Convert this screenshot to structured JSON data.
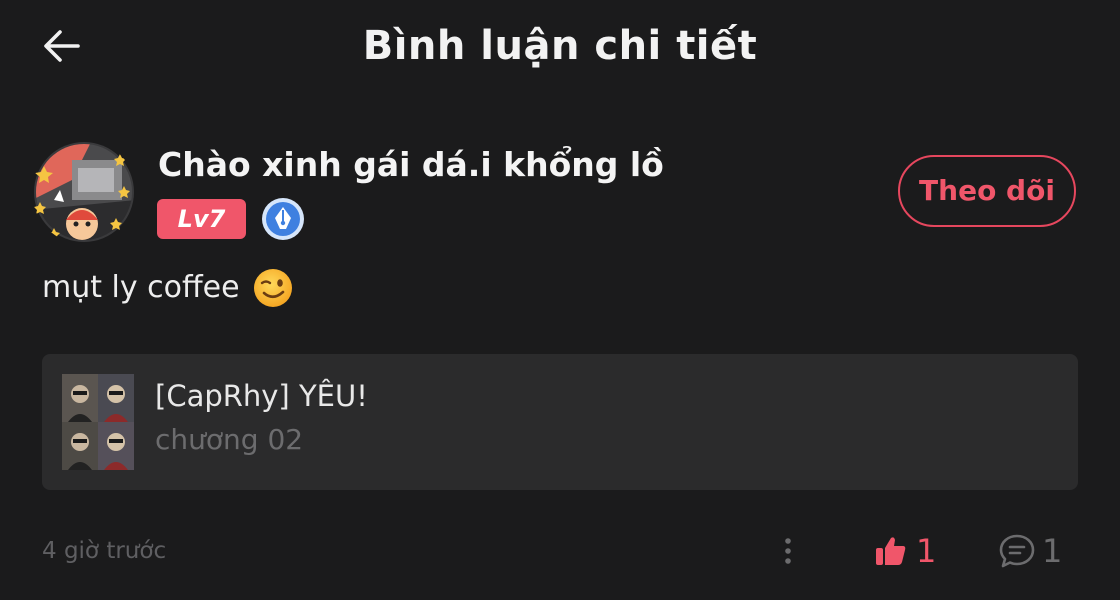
{
  "header": {
    "title": "Bình luận chi tiết",
    "back_icon": "arrow-left-icon"
  },
  "comment": {
    "author": {
      "name": "Chào xinh gái dá.i khổng lồ",
      "level": "Lv7",
      "avatar_icon": "user-avatar",
      "badge_icon": "pen-nib-badge-icon"
    },
    "follow_label": "Theo dõi",
    "text": "mụt ly coffee",
    "emoji": "winking-face-emoji",
    "reference": {
      "title": "[CapRhy] YÊU!",
      "subtitle": "chương 02",
      "thumbnail": "comic-cover-thumbnail"
    },
    "time": "4 giờ trước",
    "likes": "1",
    "replies": "1"
  },
  "colors": {
    "background": "#1b1b1c",
    "accent": "#f0566a",
    "card": "#2b2b2c",
    "muted": "#6c6c6e",
    "badge_blue": "#4a8be8"
  }
}
